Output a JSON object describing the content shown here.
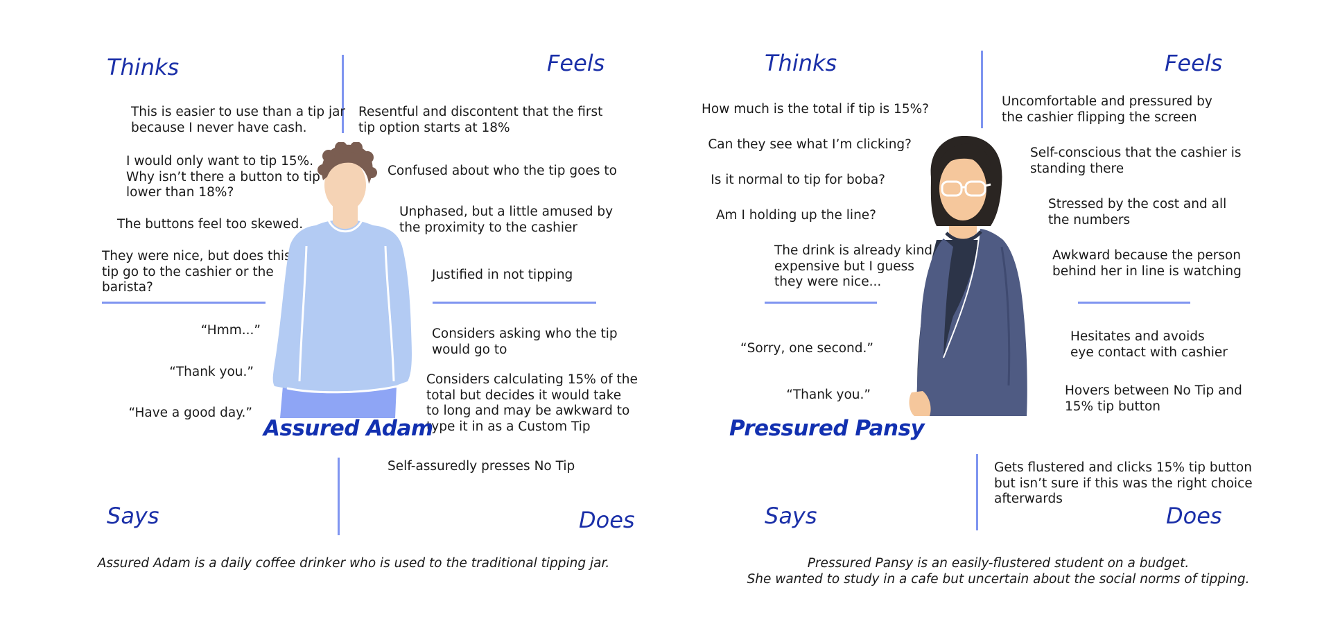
{
  "maps": [
    {
      "persona": "Assured Adam",
      "quadrants": {
        "thinks": "Thinks",
        "feels": "Feels",
        "says": "Says",
        "does": "Does"
      },
      "thinks": [
        "This is easier to use than a tip jar\nbecause I never have cash.",
        "I would only want to tip 15%.\nWhy isn’t there a button to tip\nlower than 18%?",
        "The buttons feel too skewed.",
        "They were nice, but does this\ntip go to the cashier or the\nbarista?"
      ],
      "feels": [
        "Resentful and discontent that the first\ntip option starts at 18%",
        "Confused about who the tip goes to",
        "Unphased, but a little amused by\nthe proximity to the cashier",
        "Justified in not tipping"
      ],
      "says": [
        "“Hmm...”",
        "“Thank you.”",
        "“Have a good day.”"
      ],
      "does": [
        "Considers asking who the tip\nwould go to",
        "Considers calculating 15% of the\ntotal but decides it would take\nto long and may be awkward to\ntype it in as a Custom Tip",
        "Self-assuredly presses No Tip"
      ],
      "summary": "Assured Adam is a daily coffee drinker who is used to the traditional tipping jar."
    },
    {
      "persona": "Pressured Pansy",
      "quadrants": {
        "thinks": "Thinks",
        "feels": "Feels",
        "says": "Says",
        "does": "Does"
      },
      "thinks": [
        "How much is the total if tip is 15%?",
        "Can they see what I’m clicking?",
        "Is it normal to tip for boba?",
        "Am I holding up the line?",
        "The drink is already kind of\nexpensive but I guess\nthey were nice..."
      ],
      "feels": [
        "Uncomfortable and pressured by\nthe cashier flipping the screen",
        "Self-conscious that the cashier is\nstanding there",
        "Stressed by the cost and all\nthe numbers",
        "Awkward because the person\nbehind her in line is watching"
      ],
      "says": [
        "“Sorry, one second.”",
        "“Thank you.”"
      ],
      "does": [
        "Hesitates and avoids\neye contact with cashier",
        "Hovers between No Tip and\n15% tip button",
        "Gets flustered and clicks 15% tip button\nbut isn’t sure if this was the right choice\nafterwards"
      ],
      "summary": "Pressured Pansy is an easily-flustered student on a budget.\nShe wanted to study in a cafe but uncertain about the social norms of tipping."
    }
  ],
  "colors": {
    "accent": "#1a2fa8",
    "divider": "#7f95f0",
    "adam_shirt": "#b3cbf3",
    "adam_pants": "#8ea5f5",
    "adam_skin": "#f5d3b5",
    "adam_hair": "#7a5d51",
    "pansy_jacket": "#4f5b83",
    "pansy_inner": "#2c3448",
    "pansy_hair": "#2a2522",
    "pansy_skin": "#f5c79c"
  }
}
